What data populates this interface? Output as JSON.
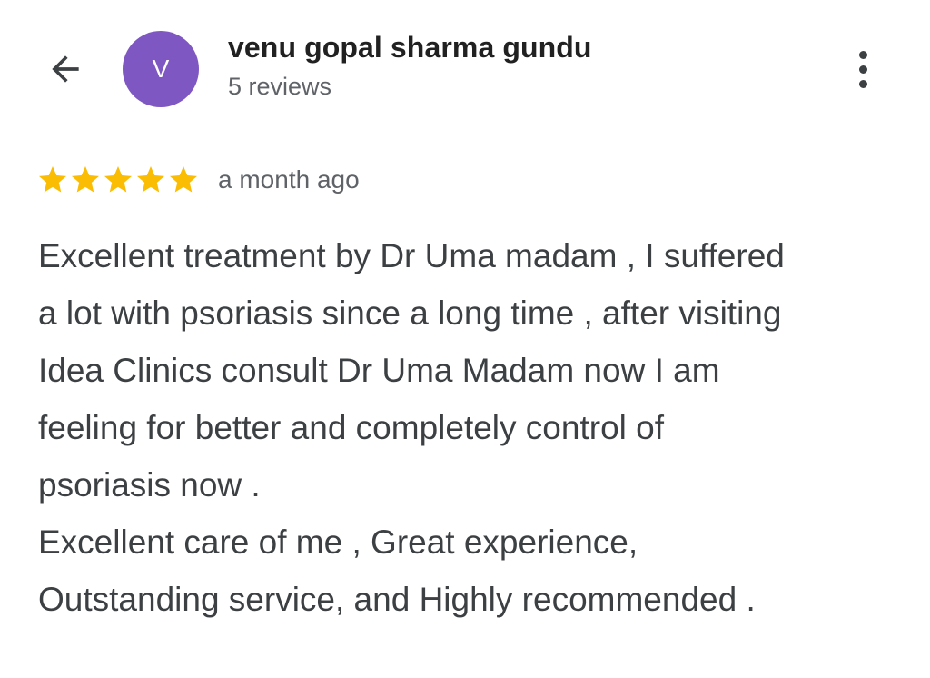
{
  "header": {
    "back_icon": "arrow-back-icon",
    "avatar_letter": "V",
    "avatar_color": "#7e57c2",
    "reviewer_name": "venu gopal sharma gundu",
    "review_count": "5 reviews",
    "more_icon": "more-vert-icon"
  },
  "review": {
    "rating": 5,
    "rating_max": 5,
    "star_color": "#fbbc04",
    "timestamp": "a month ago",
    "lines": [
      "Excellent treatment by Dr Uma madam , I suffered",
      "a lot with psoriasis since a long time , after visiting",
      "Idea Clinics consult Dr Uma Madam now I am",
      "feeling for better and completely control of",
      "psoriasis now .",
      "Excellent care of me , Great experience,",
      "Outstanding service, and Highly recommended ."
    ]
  }
}
